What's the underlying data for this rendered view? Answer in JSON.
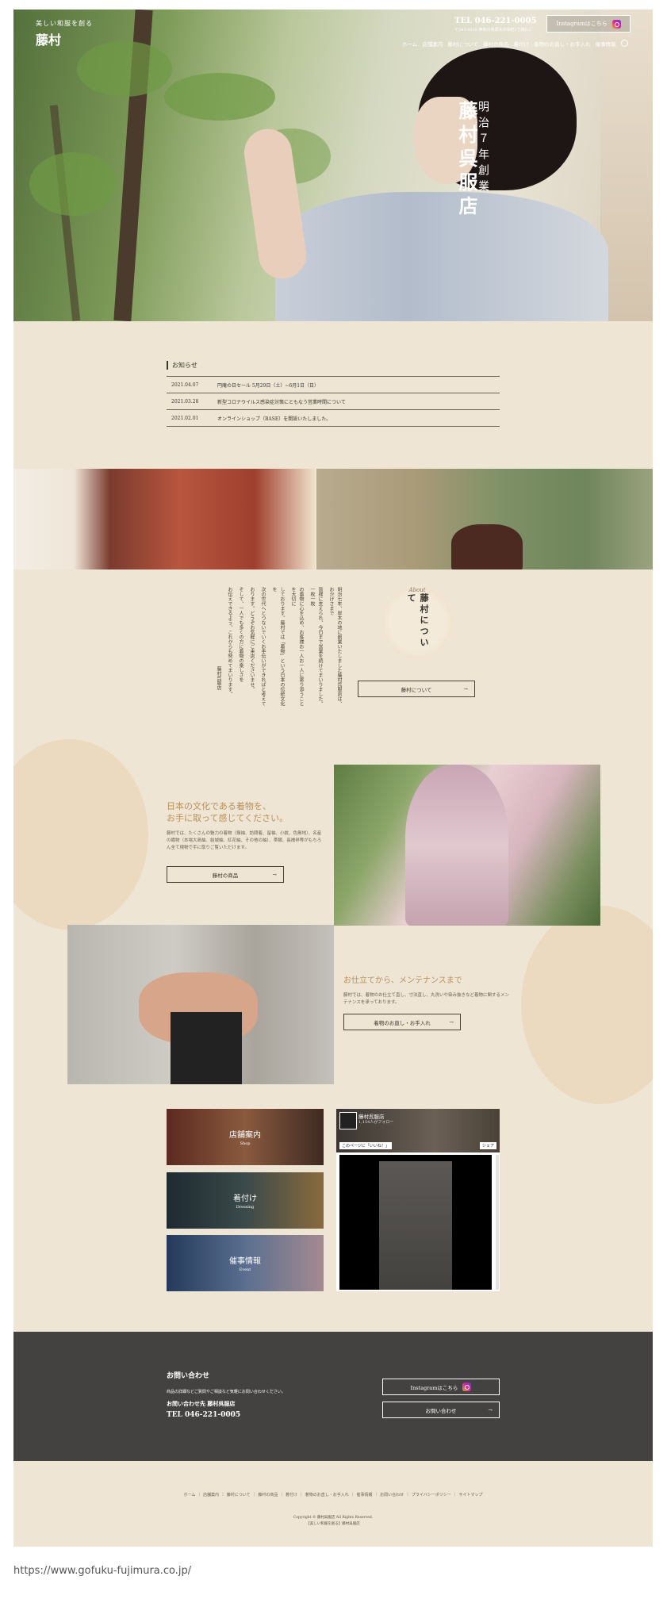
{
  "header": {
    "logo_tagline": "美しい和服を創る",
    "logo_name": "藤村",
    "tel": "TEL 046-221-0005",
    "address": "〒243-0018 神奈川県厚木市中町2丁目6-2",
    "instagram_label": "Instagramはこちら",
    "nav": [
      "ホーム",
      "店舗案内",
      "藤村について",
      "藤村の商品",
      "着付け",
      "着物のお直し・お手入れ",
      "催事情報"
    ]
  },
  "hero": {
    "subtitle": "明治７年創業",
    "title": "藤村呉服店"
  },
  "news": {
    "heading": "お知らせ",
    "items": [
      {
        "date": "2021.04.07",
        "text": "円庵の日セール 5月29日（土）~6月1日（日）"
      },
      {
        "date": "2021.03.28",
        "text": "新型コロナウイルス感染症対策にともなう営業時間について"
      },
      {
        "date": "2021.02.01",
        "text": "オンラインショップ（BASE）を開設いたしました。"
      }
    ]
  },
  "about": {
    "badge_en": "About",
    "badge_jp": "藤村について",
    "columns": [
      "明治七年、厚木の地に創業いたしました藤村呉服店は、おかげさまで",
      "皆様に支えられ、今日まで営業を続けてまいりました。一枚一枚",
      "の着物に心を込め、お客様お一人お一人に寄り添うことを大切に",
      "しております。藤村では「着物」という日本の伝統文化を",
      "次の世代へとつないでいくお手伝いができればと考えて",
      "おります。どうぞお気軽にご来店くださいませ。",
      "そして、一人でも多くの方に着物の楽しさを",
      "お伝えできるよう、これからも努めてまいります。",
      "藤村呉服店"
    ],
    "button": "藤村について"
  },
  "products": {
    "heading_line1": "日本の文化である着物を、",
    "heading_line2": "お手に取って感じてください。",
    "text": "藤村では、たくさんの魅力の着物（振袖、訪問着、留袖、小紋、色無地）、名産の織物（本場大島紬、結城紬、紅花紬、その他の紬）、帯類、長襦袢等がもちろん全て現物で手に取りご覧いただけます。",
    "button": "藤村の商品"
  },
  "maintenance": {
    "heading": "お仕立てから、メンテナンスまで",
    "text": "藤村では、着物のお仕立て直し、寸法直し、丸洗いや染み抜きなど着物に関するメンテナンスを承っております。",
    "button": "着物のお直し・お手入れ"
  },
  "tiles": [
    {
      "title": "店舗案内",
      "sub": "Shop"
    },
    {
      "title": "着付け",
      "sub": "Dressing"
    },
    {
      "title": "催事情報",
      "sub": "Event"
    }
  ],
  "facebook": {
    "page_name": "藤村呉服店",
    "followers": "1,154人がフォロー",
    "like": "このページに「いいね！」",
    "share": "シェア"
  },
  "contact": {
    "heading": "お問い合わせ",
    "text": "商品の詳細などご質問やご相談など気軽にお問い合わせください。",
    "to": "お問い合わせ先 藤村呉服店",
    "tel": "TEL 046-221-0005",
    "instagram_label": "Instagramはこちら",
    "form_label": "お問い合わせ"
  },
  "footer": {
    "nav": [
      "ホーム",
      "店舗案内",
      "藤村について",
      "藤村の商品",
      "着付け",
      "着物のお直し・お手入れ",
      "催事情報",
      "お問い合わせ",
      "プライバシーポリシー",
      "サイトマップ"
    ],
    "copyright": "Copyright © 藤村呉服店 All Rights Reserved.",
    "note": "【美しい和服を創る】藤村呉服店"
  },
  "url": "https://www.gofuku-fujimura.co.jp/",
  "colors": {
    "background": "#efe5d4",
    "accent": "#b8905a",
    "contact_bg": "#444240"
  }
}
